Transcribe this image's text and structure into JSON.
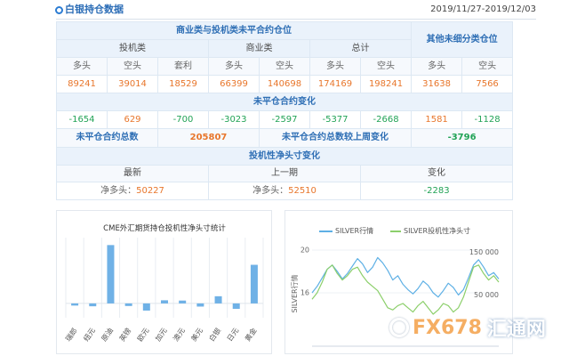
{
  "header": {
    "title": "白银持仓数据",
    "date_range": "2019/11/27-2019/12/03"
  },
  "icons": {
    "title_bullet": "circle-bullet-icon",
    "watermark_logo": "fx678-logo-icon",
    "legend_swatch": "line-swatch-icon"
  },
  "colors": {
    "accent": "#2f6fb5",
    "up": "#e8762b",
    "down": "#22a356",
    "header_bg": "#eaf2fb",
    "bar": "#6fb1e6",
    "line_price": "#5eb0e5",
    "line_position": "#8ccf6b"
  },
  "table": {
    "group_title": "商业类与投机类未平合约仓位",
    "other_title": "其他未细分类仓位",
    "groups": [
      "投机类",
      "商业类",
      "总计"
    ],
    "subheaders": [
      "多头",
      "空头",
      "套利",
      "多头",
      "空头",
      "多头",
      "空头",
      "多头",
      "空头"
    ],
    "positions": [
      "89241",
      "39014",
      "18529",
      "66399",
      "140698",
      "174169",
      "198241",
      "31638",
      "7566"
    ],
    "change_title": "未平仓合约变化",
    "changes": [
      "-1654",
      "629",
      "-700",
      "-3023",
      "-2597",
      "-5377",
      "-2668",
      "1581",
      "-1128"
    ],
    "total_label": "未平仓合约总数",
    "total_value": "205807",
    "total_change_label": "未平仓合约总数较上周变化",
    "total_change_value": "-3796",
    "net_title": "投机性净头寸变化",
    "net_headers": [
      "最新",
      "上一期",
      "变化"
    ],
    "net_latest_label": "净多头：",
    "net_latest": "50227",
    "net_prev_label": "净多头：",
    "net_prev": "52510",
    "net_change": "-2283"
  },
  "watermark": {
    "brand": "FX678",
    "name": "汇通网"
  },
  "chart_data": [
    {
      "type": "bar",
      "title": "CME外汇期货持仓投机性净头寸统计",
      "categories": [
        "瑞郎",
        "纽元",
        "原油",
        "英镑",
        "欧元",
        "加元",
        "澳元",
        "美元",
        "白银",
        "日元",
        "黄金"
      ],
      "values": [
        -15000,
        -20000,
        408000,
        -18000,
        -50000,
        22000,
        20000,
        -22000,
        50227,
        -38000,
        270000
      ],
      "ylim": [
        -100000,
        460000
      ],
      "grid": true
    },
    {
      "type": "line",
      "ylabel": "SILVER行情",
      "legend_position": "top",
      "grid": true,
      "y_left": {
        "range": [
          11,
          21
        ],
        "ticks": [
          16,
          20
        ],
        "tick_labels": [
          "16",
          "20"
        ]
      },
      "y_right": {
        "range": [
          -70000,
          180000
        ],
        "ticks": [
          50000,
          150000
        ],
        "tick_labels": [
          "50 000",
          "150 000"
        ]
      },
      "series": [
        {
          "name": "SILVER行情",
          "color": "#5eb0e5",
          "values": [
            16.0,
            16.6,
            17.4,
            18.2,
            18.6,
            18.0,
            17.3,
            17.8,
            18.5,
            19.2,
            18.7,
            17.9,
            18.4,
            19.3,
            18.8,
            18.1,
            17.2,
            17.6,
            16.8,
            16.3,
            15.9,
            16.4,
            17.1,
            16.7,
            16.0,
            15.6,
            16.2,
            16.9,
            16.5,
            15.8,
            16.3,
            17.4,
            18.6,
            19.1,
            18.4,
            17.6,
            17.9,
            17.3
          ]
        },
        {
          "name": "SILVER投机性净头寸",
          "color": "#8ccf6b",
          "values": [
            40000,
            55000,
            80000,
            110000,
            120000,
            100000,
            85000,
            95000,
            110000,
            115000,
            95000,
            80000,
            70000,
            60000,
            40000,
            20000,
            15000,
            25000,
            30000,
            20000,
            10000,
            25000,
            35000,
            20000,
            5000,
            15000,
            30000,
            25000,
            10000,
            20000,
            45000,
            80000,
            115000,
            120000,
            100000,
            85000,
            95000,
            80000
          ]
        }
      ]
    }
  ]
}
